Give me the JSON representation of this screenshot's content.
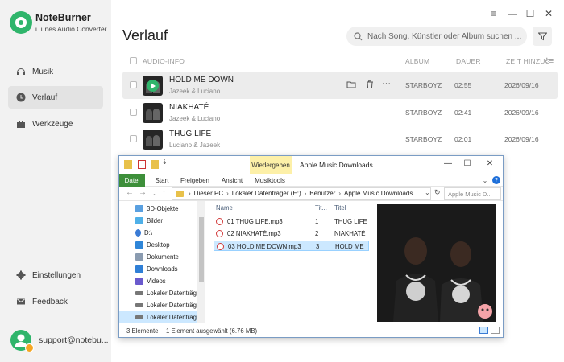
{
  "app": {
    "name": "NoteBurner",
    "subtitle": "iTunes Audio Converter",
    "accent": "#2fb56b"
  },
  "sidebar": {
    "items": [
      {
        "label": "Musik",
        "icon": "headphones-icon",
        "active": false
      },
      {
        "label": "Verlauf",
        "icon": "clock-icon",
        "active": true
      },
      {
        "label": "Werkzeuge",
        "icon": "toolbox-icon",
        "active": false
      }
    ],
    "bottom_items": [
      {
        "label": "Einstellungen",
        "icon": "gear-icon"
      },
      {
        "label": "Feedback",
        "icon": "mail-icon"
      }
    ],
    "user_email": "support@notebu..."
  },
  "window_controls": [
    "menu-icon",
    "minimize-icon",
    "maximize-icon",
    "close-icon"
  ],
  "header": {
    "title": "Verlauf",
    "search_placeholder": "Nach Song, Künstler oder Album suchen ..."
  },
  "table": {
    "columns": [
      "AUDIO-INFO",
      "ALBUM",
      "DAUER",
      "ZEIT HINZUGEF"
    ],
    "rows": [
      {
        "title": "HOLD ME DOWN",
        "artist": "Jazeek & Luciano",
        "album": "STARBOYZ",
        "duration": "02:55",
        "date": "2026/09/16",
        "hover": true
      },
      {
        "title": "NIAKHATÉ",
        "artist": "Jazeek & Luciano",
        "album": "STARBOYZ",
        "duration": "02:41",
        "date": "2026/09/16",
        "hover": false
      },
      {
        "title": "THUG LIFE",
        "artist": "Luciano & Jazeek",
        "album": "STARBOYZ",
        "duration": "02:01",
        "date": "2026/09/16",
        "hover": false
      }
    ]
  },
  "explorer": {
    "context_tab": "Wiedergeben",
    "title": "Apple Music Downloads",
    "ribbon_tabs": [
      "Datei",
      "Start",
      "Freigeben",
      "Ansicht",
      "Musiktools"
    ],
    "address": [
      "Dieser PC",
      "Lokaler Datenträger (E:)",
      "Benutzer",
      "Apple Music Downloads"
    ],
    "search_placeholder": "Apple Music D...",
    "tree": [
      {
        "label": "3D-Objekte",
        "color": "#5aa0e0"
      },
      {
        "label": "Bilder",
        "color": "#4fb0e8"
      },
      {
        "label": "D:\\",
        "color": "#3a7bd5"
      },
      {
        "label": "Desktop",
        "color": "#2f86d8"
      },
      {
        "label": "Dokumente",
        "color": "#8a9bb0"
      },
      {
        "label": "Downloads",
        "color": "#2f7fd6"
      },
      {
        "label": "Videos",
        "color": "#6a5acd"
      },
      {
        "label": "Lokaler Datenträger",
        "color": "#777777"
      },
      {
        "label": "Lokaler Datenträger",
        "color": "#777777"
      },
      {
        "label": "Lokaler Datenträger",
        "color": "#777777"
      }
    ],
    "file_columns": [
      "Name",
      "Tit...",
      "Titel"
    ],
    "files": [
      {
        "name": "01 THUG LIFE.mp3",
        "track": "1",
        "title": "THUG LIFE",
        "selected": false
      },
      {
        "name": "02 NIAKHATÉ.mp3",
        "track": "2",
        "title": "NIAKHATÉ",
        "selected": false
      },
      {
        "name": "03 HOLD ME DOWN.mp3",
        "track": "3",
        "title": "HOLD ME",
        "selected": true
      }
    ],
    "status_count": "3 Elemente",
    "status_selected": "1 Element ausgewählt (6.76 MB)"
  }
}
